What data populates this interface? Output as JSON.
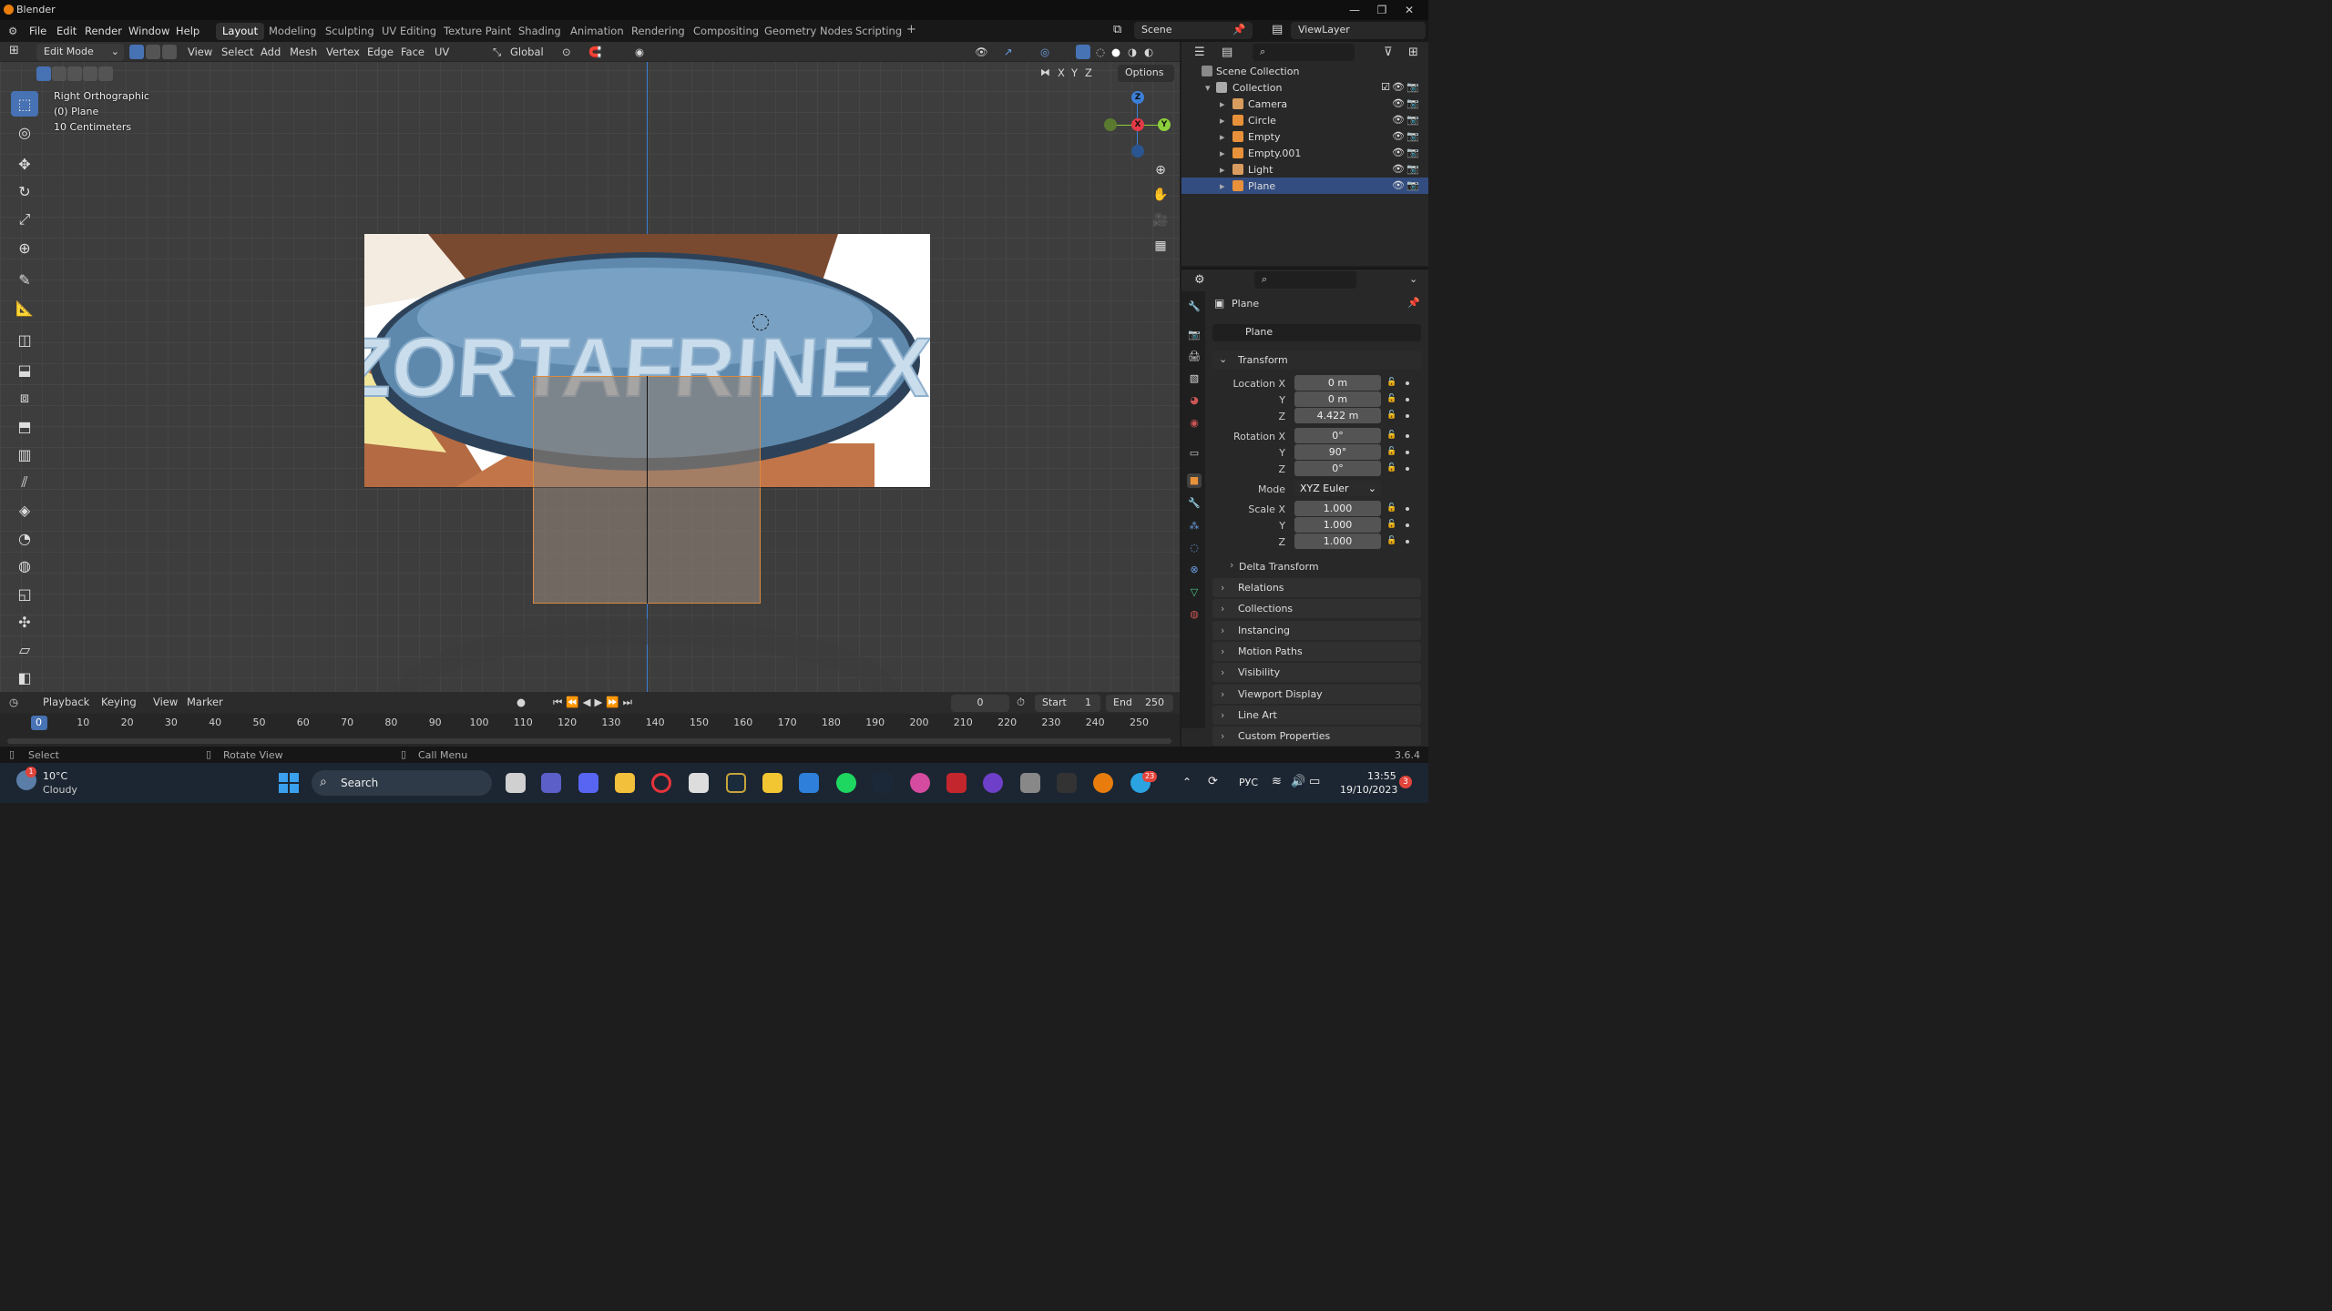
{
  "window": {
    "title": "Blender",
    "controls": [
      "—",
      "❐",
      "✕"
    ]
  },
  "menubar": {
    "menus": [
      "File",
      "Edit",
      "Render",
      "Window",
      "Help"
    ],
    "workspaces": [
      "Layout",
      "Modeling",
      "Sculpting",
      "UV Editing",
      "Texture Paint",
      "Shading",
      "Animation",
      "Rendering",
      "Compositing",
      "Geometry Nodes",
      "Scripting"
    ],
    "active_workspace": "Layout",
    "add_workspace": "+",
    "scene": "Scene",
    "view_layer": "ViewLayer"
  },
  "viewport_header": {
    "mode": "Edit Mode",
    "menus": [
      "View",
      "Select",
      "Add",
      "Mesh",
      "Vertex",
      "Edge",
      "Face",
      "UV"
    ],
    "orientation": "Global",
    "axis_x": "X",
    "axis_y": "Y",
    "axis_z": "Z",
    "options": "Options"
  },
  "viewport_overlay": {
    "view_name": "Right Orthographic",
    "object": "(0) Plane",
    "scale": "10 Centimeters"
  },
  "reference_image": {
    "text": "ZORTAFRINEX"
  },
  "gizmo": {
    "z": "Z",
    "x": "X",
    "y": "Y"
  },
  "timeline": {
    "menus": [
      "Playback",
      "Keying",
      "View",
      "Marker"
    ],
    "current_frame": "0",
    "start_label": "Start",
    "start": "1",
    "end_label": "End",
    "end": "250",
    "ticks": [
      "0",
      "10",
      "20",
      "30",
      "40",
      "50",
      "60",
      "70",
      "80",
      "90",
      "100",
      "110",
      "120",
      "130",
      "140",
      "150",
      "160",
      "170",
      "180",
      "190",
      "200",
      "210",
      "220",
      "230",
      "240",
      "250"
    ]
  },
  "statusbar": {
    "select": "Select",
    "rotate": "Rotate View",
    "call_menu": "Call Menu",
    "version": "3.6.4"
  },
  "outliner": {
    "root": "Scene Collection",
    "collection": "Collection",
    "items": [
      {
        "name": "Camera",
        "color": "#d99c5f"
      },
      {
        "name": "Circle",
        "color": "#e8913a"
      },
      {
        "name": "Empty",
        "color": "#e8913a"
      },
      {
        "name": "Empty.001",
        "color": "#e8913a"
      },
      {
        "name": "Light",
        "color": "#d99c5f"
      },
      {
        "name": "Plane",
        "color": "#e8913a"
      }
    ],
    "selected": "Plane"
  },
  "properties": {
    "object_name": "Plane",
    "datablock": "Plane",
    "transform_label": "Transform",
    "location_label": "Location X",
    "location": [
      "0 m",
      "0 m",
      "4.422 m"
    ],
    "rotation_label": "Rotation X",
    "rotation": [
      "0°",
      "90°",
      "0°"
    ],
    "mode_label": "Mode",
    "mode": "XYZ Euler",
    "scale_label": "Scale X",
    "scale": [
      "1.000",
      "1.000",
      "1.000"
    ],
    "y_label": "Y",
    "z_label": "Z",
    "delta": "Delta Transform",
    "sections": [
      "Relations",
      "Collections",
      "Instancing",
      "Motion Paths",
      "Visibility",
      "Viewport Display",
      "Line Art",
      "Custom Properties"
    ]
  },
  "taskbar": {
    "weather_temp": "10°C",
    "weather_desc": "Cloudy",
    "weather_badge": "1",
    "search": "Search",
    "lang": "РУС",
    "time": "13:55",
    "date": "19/10/2023",
    "notif": "3",
    "telegram_badge": "23"
  },
  "colors": {
    "accent": "#4772b3",
    "select": "#334d80",
    "x_axis": "#e63946",
    "y_axis": "#8ccf3c",
    "z_axis": "#3c7fd8"
  }
}
